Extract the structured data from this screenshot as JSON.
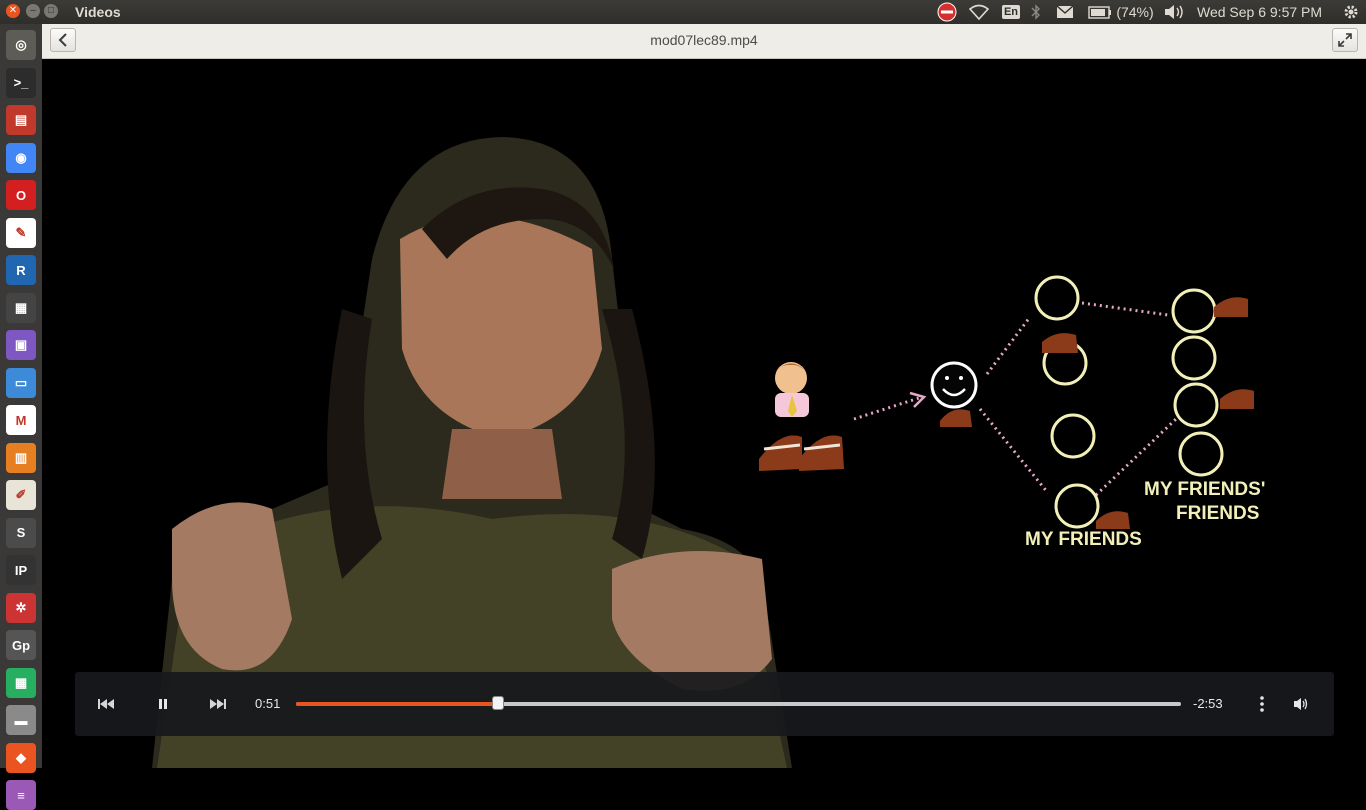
{
  "panel": {
    "app_title": "Videos",
    "language": "En",
    "battery": "(74%)",
    "clock": "Wed Sep  6  9:57 PM"
  },
  "launcher": {
    "items": [
      {
        "name": "dash-home",
        "icon": "ubuntu-icon",
        "color": "#5e5c56"
      },
      {
        "name": "terminal",
        "icon": "terminal-icon",
        "color": "#2c2c2c"
      },
      {
        "name": "archive-manager",
        "icon": "archive-icon",
        "color": "#c0392b"
      },
      {
        "name": "chrome",
        "icon": "chrome-icon",
        "color": "#4285f4"
      },
      {
        "name": "opera",
        "icon": "opera-icon",
        "color": "#d31f1f"
      },
      {
        "name": "pdf-reader",
        "icon": "pdf-icon",
        "color": "#ffffff"
      },
      {
        "name": "r-studio",
        "icon": "r-icon",
        "color": "#2166b0"
      },
      {
        "name": "videos",
        "icon": "clapper-icon",
        "color": "#444444"
      },
      {
        "name": "screen-recorder",
        "icon": "film-icon",
        "color": "#7e57c2"
      },
      {
        "name": "writer",
        "icon": "document-icon",
        "color": "#3d8bd8"
      },
      {
        "name": "gmail",
        "icon": "gmail-icon",
        "color": "#ffffff"
      },
      {
        "name": "impress",
        "icon": "presentation-icon",
        "color": "#e67e22"
      },
      {
        "name": "text-editor",
        "icon": "text-editor-icon",
        "color": "#e8e4d8"
      },
      {
        "name": "sublime-text",
        "icon": "sublime-icon",
        "color": "#4b4b4b"
      },
      {
        "name": "ipython",
        "icon": "ipython-icon",
        "color": "#333333"
      },
      {
        "name": "settings-tool",
        "icon": "wheel-icon",
        "color": "#cc3333"
      },
      {
        "name": "gp-app",
        "icon": "gp-icon",
        "color": "#555555"
      },
      {
        "name": "calc",
        "icon": "spreadsheet-icon",
        "color": "#27ae60"
      },
      {
        "name": "files",
        "icon": "drive-icon",
        "color": "#8a8a8a"
      },
      {
        "name": "software-center",
        "icon": "bag-icon",
        "color": "#e95420"
      },
      {
        "name": "trash-or-extra",
        "icon": "stack-icon",
        "color": "#9b59b6"
      }
    ]
  },
  "header": {
    "file_title": "mod07lec89.mp4"
  },
  "video_overlay": {
    "label_friends": "MY FRIENDS",
    "label_fof_1": "MY FRIENDS'",
    "label_fof_2": "FRIENDS"
  },
  "player": {
    "elapsed": "0:51",
    "remaining": "-2:53",
    "progress": 0.228,
    "accent": "#e95420"
  }
}
